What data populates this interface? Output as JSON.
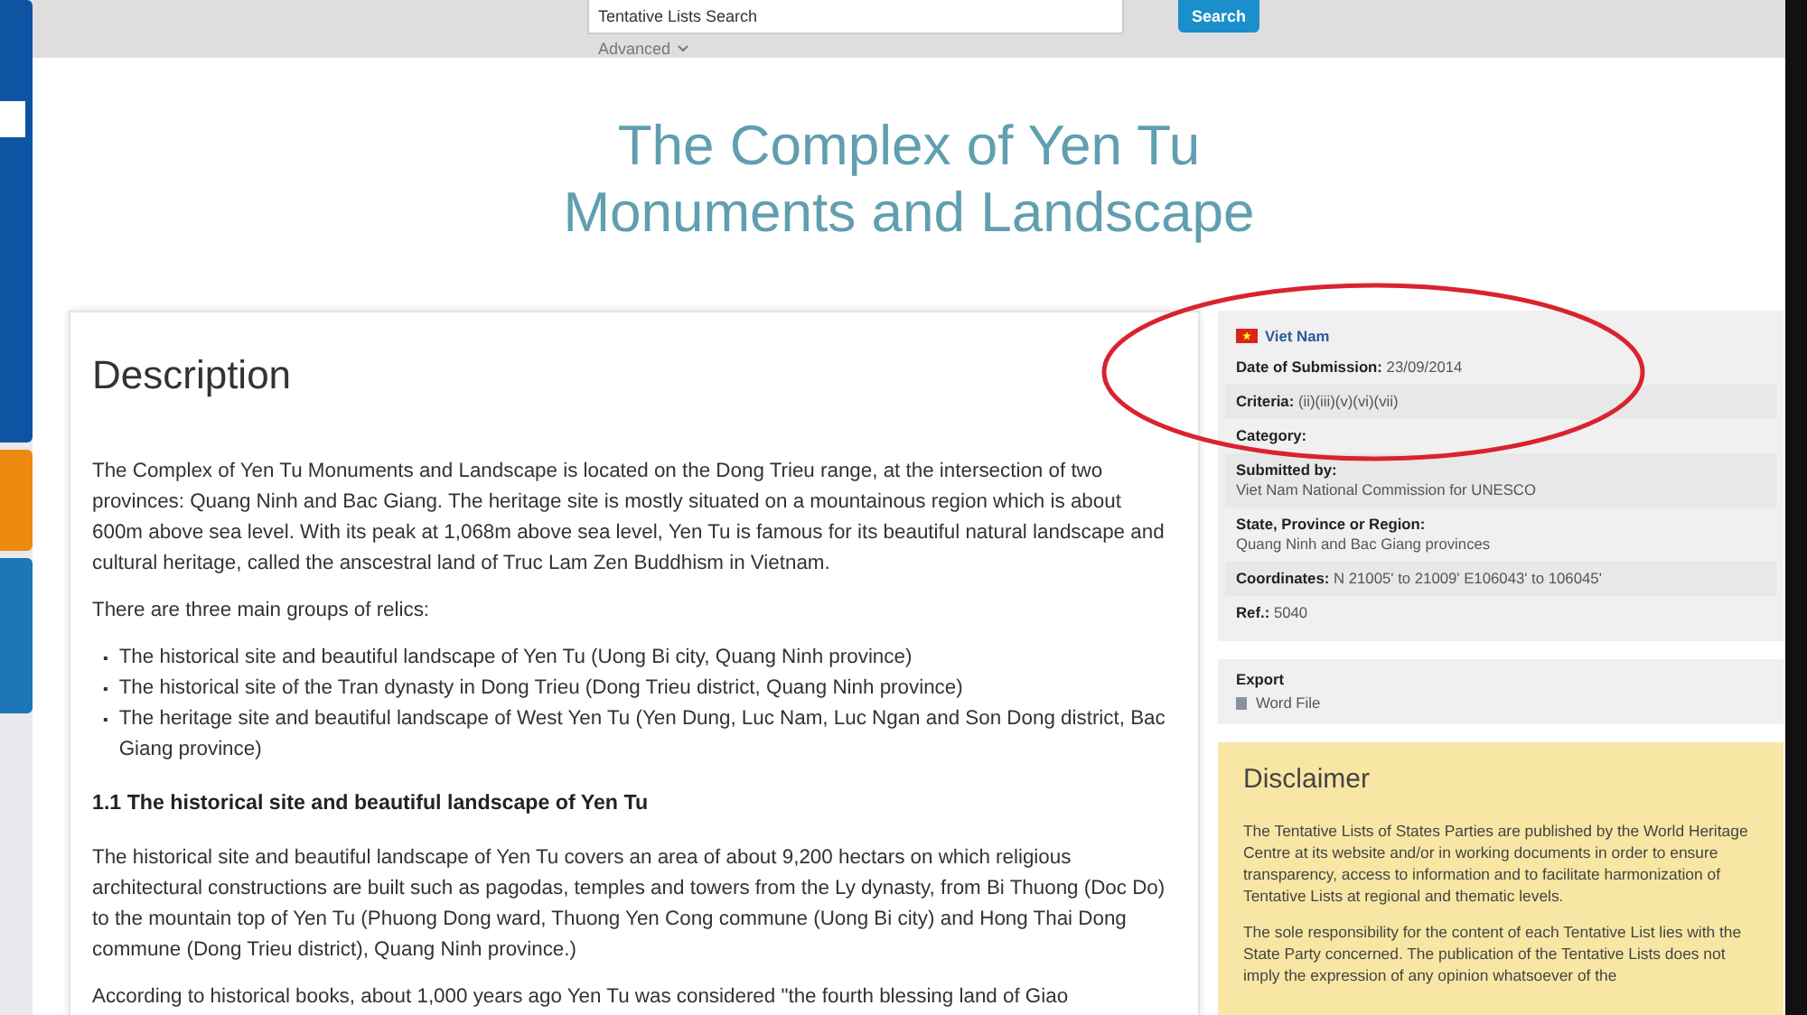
{
  "search": {
    "value": "Tentative Lists Search",
    "button": "Search",
    "advanced": "Advanced"
  },
  "title_lines": [
    "The Complex of Yen Tu",
    "Monuments and Landscape"
  ],
  "description": {
    "heading": "Description",
    "intro": "The Complex of Yen Tu Monuments and Landscape is located on the Dong Trieu range, at the intersection of two provinces: Quang Ninh and Bac Giang. The heritage site is mostly situated on a mountainous region which is about 600m above sea level. With its peak at 1,068m above sea level, Yen Tu is famous for its beautiful natural landscape and cultural heritage, called the anscestral land of Truc Lam Zen Buddhism in Vietnam.",
    "groups_intro": "There are three main groups of relics:",
    "groups": [
      {
        "marker": "▪",
        "text": "The historical site and beautiful landscape of Yen Tu (Uong Bi city, Quang Ninh province)"
      },
      {
        "marker": "▪",
        "text": "The historical site of the Tran dynasty in Dong Trieu (Dong Trieu district, Quang Ninh province)"
      },
      {
        "marker": "▪",
        "text": "The heritage site and beautiful landscape of West Yen Tu (Yen Dung, Luc Nam, Luc Ngan and Son Dong district, Bac Giang province)"
      }
    ],
    "subheading": "1.1 The historical site and beautiful landscape of Yen Tu",
    "paragraphs": [
      "The historical site and beautiful landscape of Yen Tu covers an area of about 9,200 hectars on which religious architectural constructions are built such as pagodas, temples and towers from the Ly dynasty, from Bi Thuong (Doc Do) to the mountain top of Yen Tu (Phuong Dong ward, Thuong Yen Cong commune (Uong Bi city) and Hong Thai Dong commune (Dong Trieu district), Quang Ninh province.)",
      "According to historical books, about 1,000 years ago Yen Tu was considered \"the fourth blessing land of Giao"
    ]
  },
  "info": {
    "country": "Viet Nam",
    "fields": [
      {
        "kind": "inline",
        "label": "Date of Submission:",
        "value": "23/09/2014"
      },
      {
        "kind": "inline",
        "label": "Criteria:",
        "value": "(ii)(iii)(v)(vi)(vii)"
      },
      {
        "kind": "inline",
        "label": "Category:"
      },
      {
        "kind": "block",
        "label": "Submitted by:",
        "value": "Viet Nam National Commission for UNESCO"
      },
      {
        "kind": "block",
        "label": "State, Province or Region:",
        "value": "Quang Ninh and Bac Giang provinces"
      },
      {
        "kind": "inline",
        "label": "Coordinates:",
        "value": "N 21005' to 21009' E106043' to 106045'"
      },
      {
        "kind": "inline",
        "label": "Ref.:",
        "value": "5040"
      }
    ]
  },
  "export": {
    "heading": "Export",
    "link": "Word File"
  },
  "disclaimer": {
    "heading": "Disclaimer",
    "paragraphs": [
      "The Tentative Lists of States Parties are published by the World Heritage Centre at its website and/or in working documents in order to ensure transparency, access to information and to facilitate harmonization of Tentative Lists at regional and thematic levels.",
      "The sole responsibility for the content of each Tentative List lies with the State Party concerned. The publication of the Tentative Lists does not imply the expression of any opinion whatsoever of the"
    ]
  }
}
